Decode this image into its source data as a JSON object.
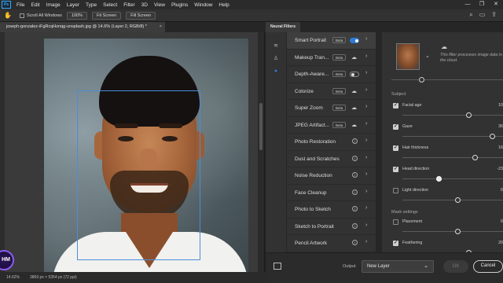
{
  "menubar": {
    "logo": "Ps",
    "items": [
      "File",
      "Edit",
      "Image",
      "Layer",
      "Type",
      "Select",
      "Filter",
      "3D",
      "View",
      "Plugins",
      "Window",
      "Help"
    ],
    "window_controls": [
      "—",
      "❐",
      "✕"
    ]
  },
  "options_bar": {
    "tool_icon": "hand-icon",
    "scroll_all_windows": "Scroll All Windows",
    "zoom_value": "100%",
    "fit_screen": "Fit Screen",
    "fill_screen": "Fill Screen"
  },
  "document": {
    "tab_title": "joseph-gonzalez-iFgRcqHznqg-unsplash.jpg @ 14.6% (Layer 2, RGB/8) *",
    "close": "×"
  },
  "status_bar": {
    "zoom": "14.62%",
    "info": "3869 px × 5354 px (72 ppi)"
  },
  "badge": "HM",
  "neural_filters": {
    "panel_title": "Neural Filters",
    "filters": [
      {
        "label": "Smart Portrait",
        "beta": "Beta",
        "control": "toggle-on"
      },
      {
        "label": "Makeup Tran...",
        "beta": "Beta",
        "control": "cloud"
      },
      {
        "label": "Depth-Aware...",
        "beta": "Beta",
        "control": "toggle-off"
      },
      {
        "label": "Colorize",
        "beta": "Beta",
        "control": "cloud"
      },
      {
        "label": "Super Zoom",
        "beta": "Beta",
        "control": "cloud"
      },
      {
        "label": "JPEG Artifact...",
        "beta": "Beta",
        "control": "cloud"
      },
      {
        "label": "Photo Restoration",
        "beta": "",
        "control": "info"
      },
      {
        "label": "Dust and Scratches",
        "beta": "",
        "control": "info"
      },
      {
        "label": "Noise Reduction",
        "beta": "",
        "control": "info"
      },
      {
        "label": "Face Cleanup",
        "beta": "",
        "control": "info"
      },
      {
        "label": "Photo to Sketch",
        "beta": "",
        "control": "info"
      },
      {
        "label": "Sketch to Portrait",
        "beta": "",
        "control": "info"
      },
      {
        "label": "Pencil Artwork",
        "beta": "",
        "control": "info"
      }
    ],
    "cloud_note": "This filter processes image data in the cloud.",
    "subject_label": "Subject",
    "mask_label": "Mask settings",
    "params": [
      {
        "label": "Facial age",
        "value": "10",
        "checked": true,
        "level": 0.6
      },
      {
        "label": "Gaze",
        "value": "36",
        "checked": true,
        "level": 0.82
      },
      {
        "label": "Hair thickness",
        "value": "16",
        "checked": true,
        "level": 0.66
      },
      {
        "label": "Head direction",
        "value": "-23",
        "checked": true,
        "level": 0.33
      },
      {
        "label": "Light direction",
        "value": "0",
        "checked": false,
        "level": 0.5
      },
      {
        "label": "Placement",
        "value": "0",
        "checked": false,
        "level": 0.5
      },
      {
        "label": "Feathering",
        "value": "20",
        "checked": true,
        "level": 0.6
      }
    ],
    "output_label": "Output",
    "output_value": "New Layer",
    "ok": "OK",
    "cancel": "Cancel"
  }
}
